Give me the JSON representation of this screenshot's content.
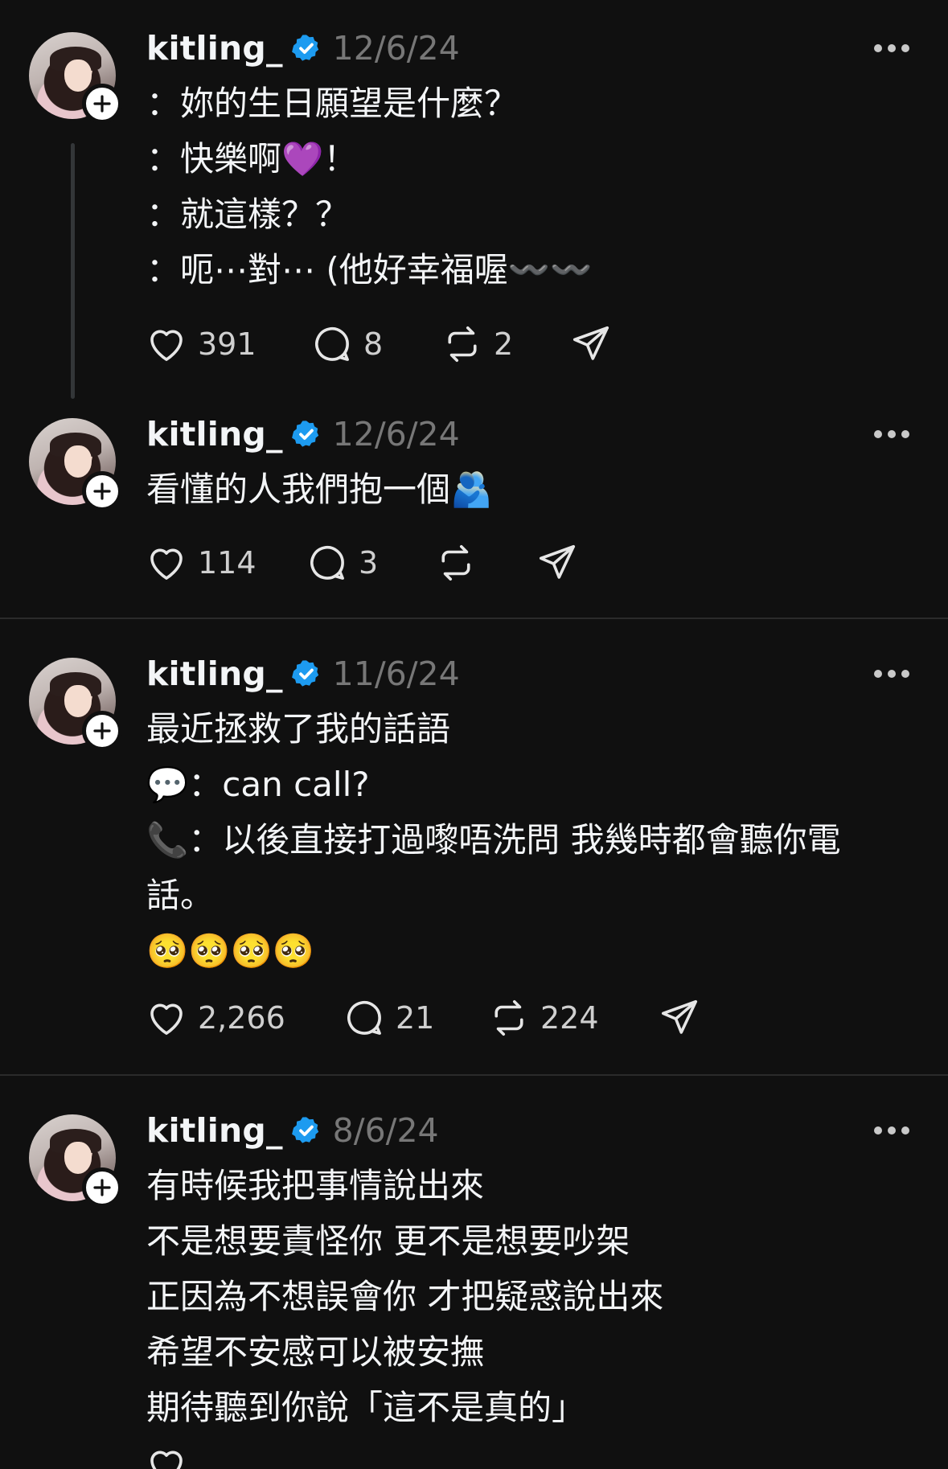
{
  "accent": {
    "verified": "#1d9bf0",
    "background": "#101010",
    "muted": "#777777"
  },
  "posts": [
    {
      "username": "kitling_",
      "date": "12/6/24",
      "lines": [
        "：妳的生日願望是什麼？",
        "：快樂啊💜！",
        "：就這樣？？",
        "：呃⋯對⋯ (他好幸福喔〰️〰️"
      ],
      "likes": "391",
      "replies": "8",
      "reposts": "2"
    },
    {
      "username": "kitling_",
      "date": "12/6/24",
      "lines": [
        "看懂的人我們抱一個🫂"
      ],
      "likes": "114",
      "replies": "3",
      "reposts": ""
    },
    {
      "username": "kitling_",
      "date": "11/6/24",
      "lines": [
        "最近拯救了我的話語",
        "💬：can call?",
        "📞：以後直接打過嚟唔洗問 我幾時都會聽你電",
        "話。",
        "🥺🥺🥺🥺"
      ],
      "likes": "2,266",
      "replies": "21",
      "reposts": "224"
    },
    {
      "username": "kitling_",
      "date": "8/6/24",
      "lines": [
        "有時候我把事情說出來",
        "不是想要責怪你 更不是想要吵架",
        "正因為不想誤會你 才把疑惑說出來",
        "希望不安感可以被安撫",
        "期待聽到你說「這不是真的」"
      ]
    }
  ],
  "icons": [
    "heart-icon",
    "comment-icon",
    "repost-icon",
    "share-icon",
    "verified-icon",
    "more-icon",
    "plus-icon"
  ]
}
